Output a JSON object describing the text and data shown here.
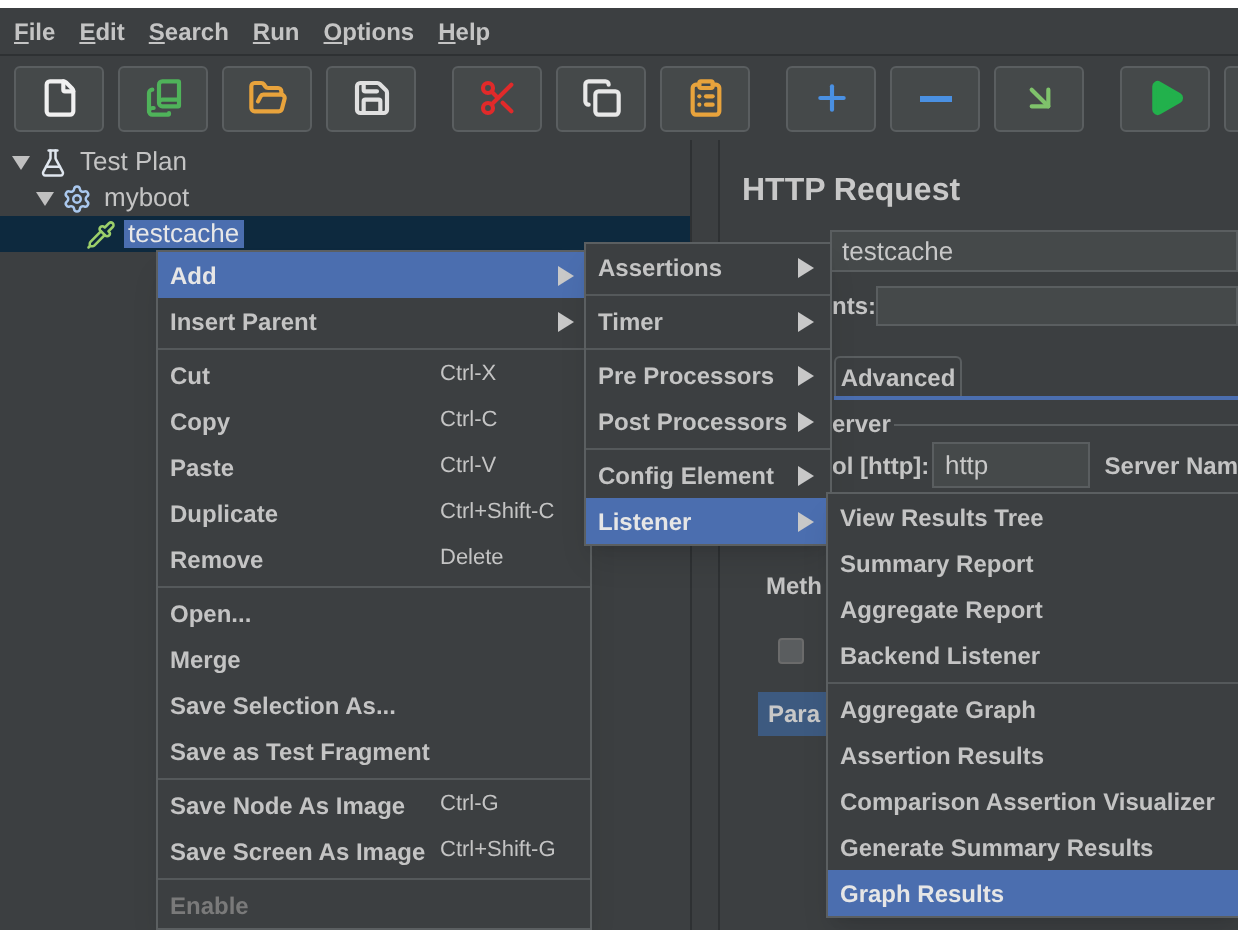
{
  "menu_bar": [
    {
      "label": "File"
    },
    {
      "label": "Edit"
    },
    {
      "label": "Search"
    },
    {
      "label": "Run"
    },
    {
      "label": "Options"
    },
    {
      "label": "Help"
    }
  ],
  "toolbar": {
    "groups": [
      {
        "buttons": [
          {
            "kind": "new"
          },
          {
            "kind": "templates"
          },
          {
            "kind": "open"
          },
          {
            "kind": "save"
          }
        ]
      },
      {
        "buttons": [
          {
            "kind": "cut"
          },
          {
            "kind": "copy"
          },
          {
            "kind": "paste"
          }
        ]
      },
      {
        "buttons": [
          {
            "kind": "expand"
          },
          {
            "kind": "collapse"
          },
          {
            "kind": "toggle"
          }
        ]
      },
      {
        "buttons": [
          {
            "kind": "start"
          },
          {
            "kind": "blank"
          }
        ]
      }
    ]
  },
  "tree": [
    {
      "label": "Test Plan",
      "kind": "plan",
      "expanded": true,
      "selected": false,
      "children": [
        {
          "label": "myboot",
          "kind": "thread_group",
          "expanded": true,
          "selected": false,
          "children": [
            {
              "label": "testcache",
              "kind": "sampler",
              "selected": true
            }
          ]
        }
      ]
    }
  ],
  "editor": {
    "title": "HTTP Request",
    "name_value": "testcache",
    "comments_label": "nts:",
    "tab": "Advanced",
    "group_title": "erver",
    "protocol_label": "ol [http]:",
    "protocol_value": "http",
    "server_label": "Server Nam",
    "method_label": "Meth",
    "checkbox_checked": false,
    "params_tab": "Para"
  },
  "context_menu": {
    "groups": [
      {
        "items": [
          {
            "label": "Add",
            "submenu": true,
            "selected": true,
            "disabled": false
          },
          {
            "label": "Insert Parent",
            "submenu": true,
            "selected": false,
            "disabled": false
          }
        ]
      },
      {
        "items": [
          {
            "label": "Cut",
            "shortcut": "Ctrl-X",
            "submenu": false,
            "selected": false,
            "disabled": false
          },
          {
            "label": "Copy",
            "shortcut": "Ctrl-C",
            "submenu": false,
            "selected": false,
            "disabled": false
          },
          {
            "label": "Paste",
            "shortcut": "Ctrl-V",
            "submenu": false,
            "selected": false,
            "disabled": false
          },
          {
            "label": "Duplicate",
            "shortcut": "Ctrl+Shift-C",
            "submenu": false,
            "selected": false,
            "disabled": false
          },
          {
            "label": "Remove",
            "shortcut": "Delete",
            "submenu": false,
            "selected": false,
            "disabled": false
          }
        ]
      },
      {
        "items": [
          {
            "label": "Open...",
            "submenu": false,
            "selected": false,
            "disabled": false
          },
          {
            "label": "Merge",
            "submenu": false,
            "selected": false,
            "disabled": false
          },
          {
            "label": "Save Selection As...",
            "submenu": false,
            "selected": false,
            "disabled": false
          },
          {
            "label": "Save as Test Fragment",
            "submenu": false,
            "selected": false,
            "disabled": false
          }
        ]
      },
      {
        "items": [
          {
            "label": "Save Node As Image",
            "shortcut": "Ctrl-G",
            "submenu": false,
            "selected": false,
            "disabled": false
          },
          {
            "label": "Save Screen As Image",
            "shortcut": "Ctrl+Shift-G",
            "submenu": false,
            "selected": false,
            "disabled": false
          }
        ]
      },
      {
        "items": [
          {
            "label": "Enable",
            "submenu": false,
            "selected": false,
            "disabled": true
          }
        ]
      }
    ]
  },
  "add_submenu": {
    "groups": [
      {
        "items": [
          {
            "label": "Assertions",
            "submenu": true,
            "selected": false,
            "disabled": false
          }
        ]
      },
      {
        "items": [
          {
            "label": "Timer",
            "submenu": true,
            "selected": false,
            "disabled": false
          }
        ]
      },
      {
        "items": [
          {
            "label": "Pre Processors",
            "submenu": true,
            "selected": false,
            "disabled": false
          },
          {
            "label": "Post Processors",
            "submenu": true,
            "selected": false,
            "disabled": false
          }
        ]
      },
      {
        "items": [
          {
            "label": "Config Element",
            "submenu": true,
            "selected": false,
            "disabled": false
          },
          {
            "label": "Listener",
            "submenu": true,
            "selected": true,
            "disabled": false
          }
        ]
      }
    ]
  },
  "listener_submenu": {
    "groups": [
      {
        "items": [
          {
            "label": "View Results Tree",
            "submenu": false,
            "selected": false,
            "disabled": false
          },
          {
            "label": "Summary Report",
            "submenu": false,
            "selected": false,
            "disabled": false
          },
          {
            "label": "Aggregate Report",
            "submenu": false,
            "selected": false,
            "disabled": false
          },
          {
            "label": "Backend Listener",
            "submenu": false,
            "selected": false,
            "disabled": false
          }
        ]
      },
      {
        "items": [
          {
            "label": "Aggregate Graph",
            "submenu": false,
            "selected": false,
            "disabled": false
          },
          {
            "label": "Assertion Results",
            "submenu": false,
            "selected": false,
            "disabled": false
          },
          {
            "label": "Comparison Assertion Visualizer",
            "submenu": false,
            "selected": false,
            "disabled": false
          },
          {
            "label": "Generate Summary Results",
            "submenu": false,
            "selected": false,
            "disabled": false
          },
          {
            "label": "Graph Results",
            "submenu": false,
            "selected": true,
            "disabled": false
          }
        ]
      }
    ]
  }
}
